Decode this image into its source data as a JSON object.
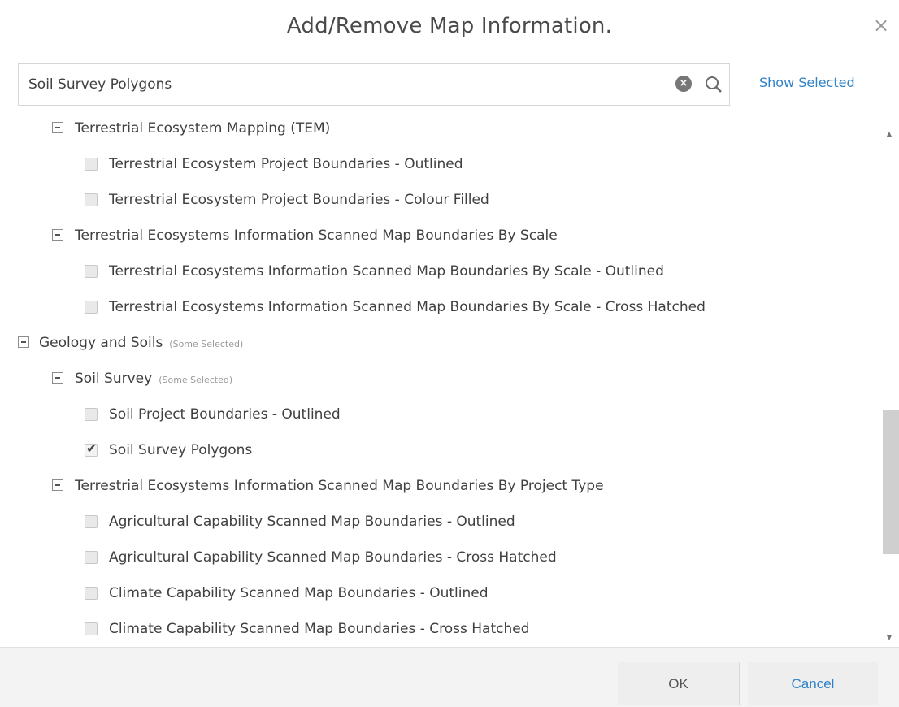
{
  "dialog": {
    "title": "Add/Remove Map Information.",
    "close_symbol": "×"
  },
  "search": {
    "value": "Soil Survey Polygons",
    "clear_icon": "clear-circle-icon",
    "search_icon": "magnifier-icon",
    "show_selected_label": "Show Selected"
  },
  "tree": {
    "rows": [
      {
        "label": "Terrestrial Ecosystem Mapping (TEM)"
      },
      {
        "label": "Terrestrial Ecosystem Project Boundaries - Outlined"
      },
      {
        "label": "Terrestrial Ecosystem Project Boundaries - Colour Filled"
      },
      {
        "label": "Terrestrial Ecosystems Information Scanned Map Boundaries By Scale"
      },
      {
        "label": "Terrestrial Ecosystems Information Scanned Map Boundaries By Scale - Outlined"
      },
      {
        "label": "Terrestrial Ecosystems Information Scanned Map Boundaries By Scale - Cross Hatched"
      },
      {
        "label": "Geology and Soils",
        "note": "(Some Selected)"
      },
      {
        "label": "Soil Survey",
        "note": "(Some Selected)"
      },
      {
        "label": "Soil Project Boundaries - Outlined"
      },
      {
        "label": "Soil Survey Polygons",
        "check": "✔"
      },
      {
        "label": "Terrestrial Ecosystems Information Scanned Map Boundaries By Project Type"
      },
      {
        "label": "Agricultural Capability Scanned Map Boundaries - Outlined"
      },
      {
        "label": "Agricultural Capability Scanned Map Boundaries - Cross Hatched"
      },
      {
        "label": "Climate Capability Scanned Map Boundaries - Outlined"
      },
      {
        "label": "Climate Capability Scanned Map Boundaries - Cross Hatched"
      }
    ]
  },
  "scrollbar": {
    "up_arrow": "▲",
    "down_arrow": "▼"
  },
  "footer": {
    "ok_label": "OK",
    "cancel_label": "Cancel"
  },
  "colors": {
    "accent": "#2f82c8",
    "text": "#404040",
    "footer_bg": "#f3f3f3"
  }
}
